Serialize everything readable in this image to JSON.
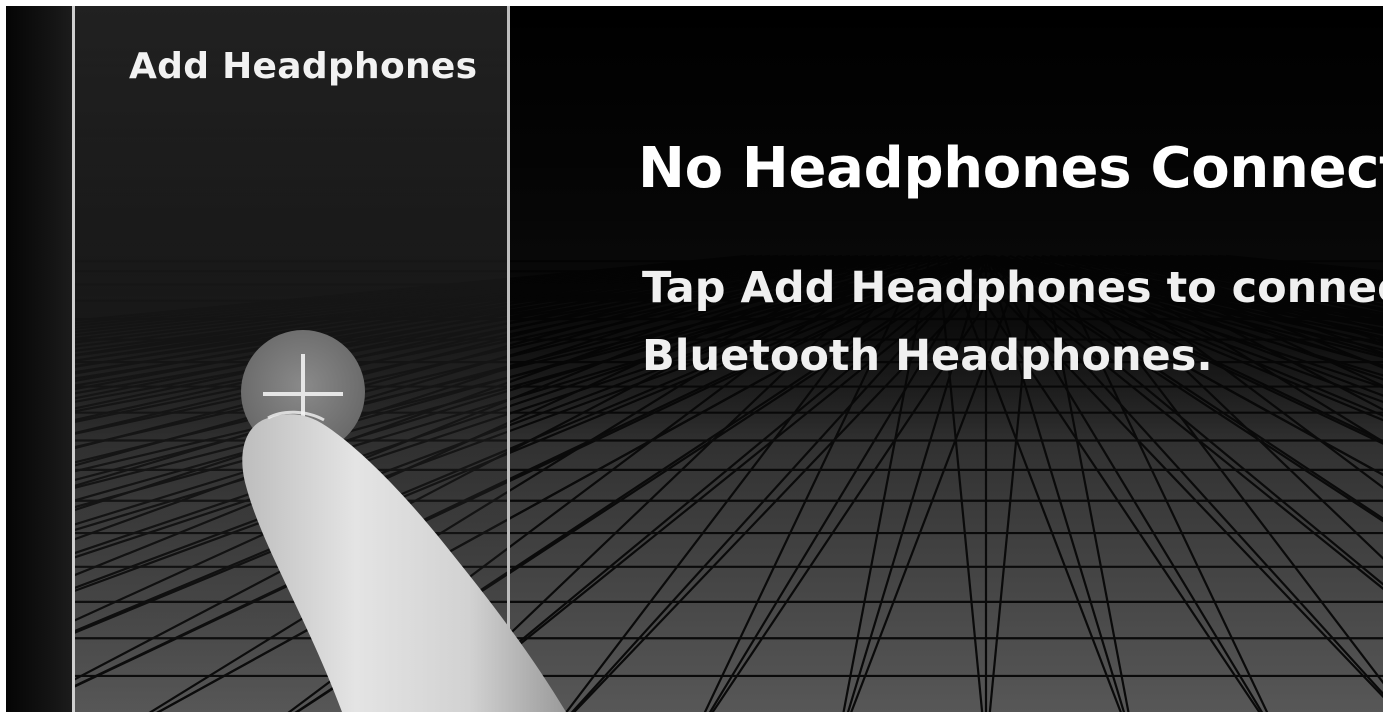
{
  "sidebar": {
    "add_headphones_label": "Add Headphones",
    "add_button_icon": "plus-icon"
  },
  "main": {
    "status_title": "No Headphones Connected",
    "status_line1": "Tap Add Headphones to connect",
    "status_line2": "Bluetooth Headphones."
  },
  "colors": {
    "background": "#0f0f0f",
    "text": "#ffffff",
    "panel_border": "#cfcfcf",
    "button_fill": "#7a7a7a"
  }
}
